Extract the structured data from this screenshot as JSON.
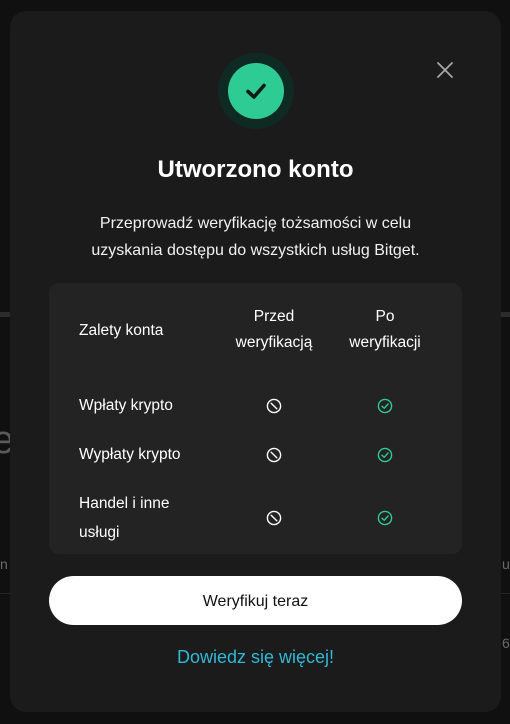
{
  "modal": {
    "title": "Utworzono konto",
    "subtitle_line1": "Przeprowadź weryfikację tożsamości w celu",
    "subtitle_line2": "uzyskania dostępu do wszystkich usług Bitget."
  },
  "table": {
    "header_benefits": "Zalety konta",
    "header_before_line1": "Przed",
    "header_before_line2": "weryfikacją",
    "header_after_line1": "Po",
    "header_after_line2": "weryfikacji",
    "rows": [
      {
        "label_line1": "Wpłaty krypto",
        "label_line2": "",
        "before": "not-allowed-icon",
        "after": "check-icon"
      },
      {
        "label_line1": "Wypłaty krypto",
        "label_line2": "",
        "before": "not-allowed-icon",
        "after": "check-icon"
      },
      {
        "label_line1": "Handel i inne",
        "label_line2": "usługi",
        "before": "not-allowed-icon",
        "after": "check-icon"
      }
    ]
  },
  "actions": {
    "verify_label": "Weryfikuj teraz",
    "learn_more_label": "Dowiedz się więcej!"
  },
  "background": {
    "frag_left_1": "e",
    "frag_left_2": "n",
    "frag_right_1": "u",
    "frag_right_2": "6"
  },
  "colors": {
    "modal_bg": "#1b1b1b",
    "card_bg": "#232323",
    "success_green": "#2fcb94",
    "link_cyan": "#2fb9d6",
    "button_bg": "#ffffff"
  }
}
